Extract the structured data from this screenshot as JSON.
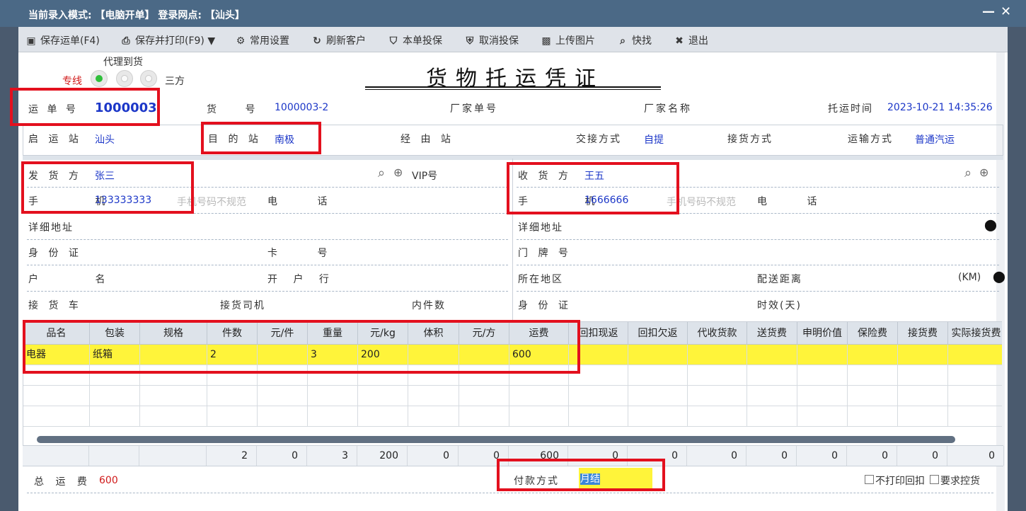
{
  "window": {
    "title": "当前录入模式: 【电脑开单】 登录网点: 【汕头】",
    "minimize": "—",
    "close": "✕"
  },
  "toolbar": {
    "save": "保存运单(F4)",
    "save_print": "保存并打印(F9)",
    "settings": "常用设置",
    "refresh": "刷新客户",
    "insure": "本单投保",
    "cancel_insure": "取消投保",
    "upload": "上传图片",
    "quick_find": "快找",
    "exit": "退出"
  },
  "mode": {
    "agent_label": "代理到货",
    "line_label": "专线",
    "third_label": "三方"
  },
  "doc": {
    "title": "货物托运凭证"
  },
  "waybill": {
    "no_label": "运 单 号",
    "no_value": "1000003",
    "goods_no_label": "货 号",
    "goods_no_value": "1000003-2",
    "factory_no_label": "厂家单号",
    "factory_name_label": "厂家名称",
    "time_label": "托运时间",
    "time_value": "2023-10-21 14:35:26"
  },
  "route": {
    "origin_label": "启 运 站",
    "origin_value": "汕头",
    "dest_label": "目 的 站",
    "dest_value": "南极",
    "via_label": "经 由 站",
    "handover_label": "交接方式",
    "handover_value": "自提",
    "pickup_label": "接货方式",
    "transport_label": "运输方式",
    "transport_value": "普通汽运"
  },
  "sender": {
    "label": "发 货 方",
    "name": "张三",
    "vip_label": "VIP号",
    "mobile_label": "手 机",
    "mobile": "133333333",
    "mobile_hint": "手机号码不规范",
    "phone_label": "电 话",
    "address_label": "详细地址",
    "id_label": "身 份 证",
    "card_label": "卡 号",
    "account_label": "户 名",
    "bank_label": "开 户 行",
    "truck_label": "接 货 车",
    "driver_label": "接货司机",
    "pieces_label": "内件数"
  },
  "receiver": {
    "label": "收 货 方",
    "name": "王五",
    "mobile_label": "手 机",
    "mobile": "1666666",
    "mobile_hint": "手机号码不规范",
    "phone_label": "电 话",
    "address_label": "详细地址",
    "door_label": "门 牌 号",
    "region_label": "所在地区",
    "distance_label": "配送距离",
    "distance_unit": "(KM)",
    "id_label": "身 份 证",
    "timeliness_label": "时效(天)"
  },
  "goods": {
    "columns": [
      "品名",
      "包装",
      "规格",
      "件数",
      "元/件",
      "重量",
      "元/kg",
      "体积",
      "元/方",
      "运费",
      "回扣现返",
      "回扣欠返",
      "代收货款",
      "送货费",
      "申明价值",
      "保险费",
      "接货费",
      "实际接货费"
    ],
    "row": [
      "电器",
      "纸箱",
      "",
      "2",
      "",
      "3",
      "200",
      "",
      "",
      "600",
      "",
      "",
      "",
      "",
      "",
      "",
      "",
      ""
    ],
    "totals": [
      "",
      "",
      "",
      "2",
      "0",
      "3",
      "200",
      "0",
      "0",
      "600",
      "0",
      "0",
      "0",
      "0",
      "0",
      "0",
      "0",
      "0"
    ]
  },
  "footer": {
    "total_label": "总 运 费",
    "total_value": "600",
    "payment_label": "付款方式",
    "payment_value": "月结",
    "no_print_rebate": "不打印回扣",
    "require_control": "要求控货"
  },
  "colors": {
    "highlight": "#e3101e",
    "value_blue": "#1c37c8",
    "row_yellow": "#fff43a",
    "titlebar": "#4b6986"
  }
}
